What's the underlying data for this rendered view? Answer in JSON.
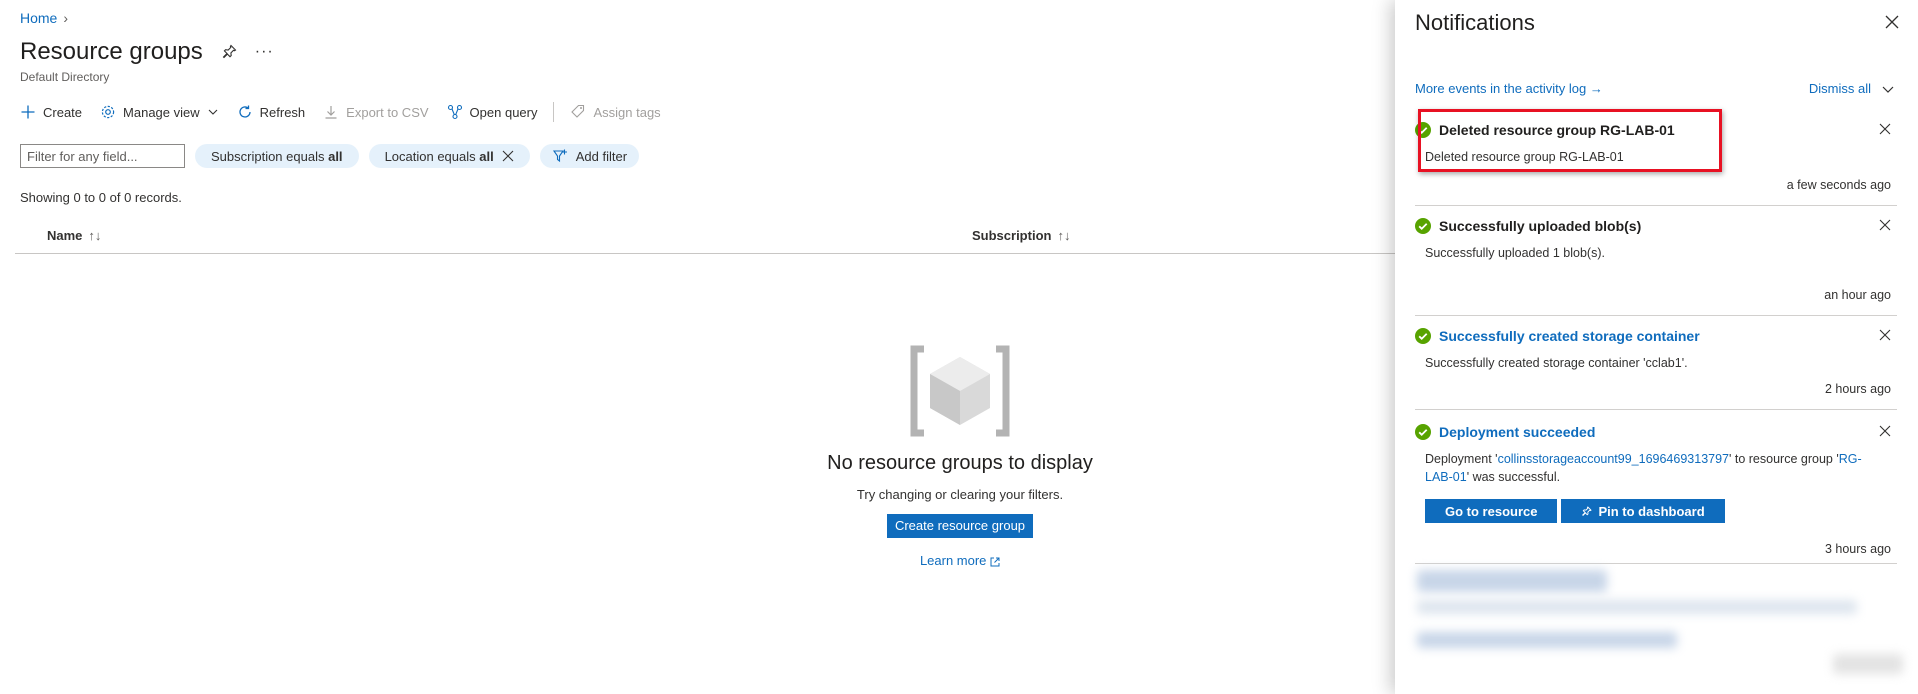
{
  "breadcrumb": {
    "home": "Home",
    "separator": "›"
  },
  "page": {
    "title": "Resource groups",
    "subtitle": "Default Directory"
  },
  "toolbar": {
    "create": "Create",
    "manage_view": "Manage view",
    "refresh": "Refresh",
    "export_csv": "Export to CSV",
    "open_query": "Open query",
    "assign_tags": "Assign tags"
  },
  "filters": {
    "placeholder": "Filter for any field...",
    "subscription_prefix": "Subscription equals",
    "subscription_value": "all",
    "location_prefix": "Location equals",
    "location_value": "all",
    "add_filter": "Add filter"
  },
  "records": "Showing 0 to 0 of 0 records.",
  "table": {
    "columns": [
      "Name",
      "Subscription"
    ]
  },
  "empty_state": {
    "title": "No resource groups to display",
    "subtitle": "Try changing or clearing your filters.",
    "button": "Create resource group",
    "learn_more": "Learn more"
  },
  "notifications": {
    "title": "Notifications",
    "activity_log": "More events in the activity log →",
    "dismiss_all": "Dismiss all",
    "items": [
      {
        "title": "Deleted resource group RG-LAB-01",
        "desc": "Deleted resource group RG-LAB-01",
        "time": "a few seconds ago"
      },
      {
        "title": "Successfully uploaded blob(s)",
        "desc": "Successfully uploaded 1 blob(s).",
        "time": "an hour ago"
      },
      {
        "title": "Successfully created storage container",
        "desc": "Successfully created storage container 'cclab1'.",
        "time": "2 hours ago"
      },
      {
        "title": "Deployment succeeded",
        "desc_prefix": "Deployment '",
        "desc_link1": "collinsstorageaccount99_1696469313797",
        "desc_mid": "' to resource group '",
        "desc_link2": "RG-LAB-01",
        "desc_suffix": "' was successful.",
        "time": "3 hours ago",
        "action_go": "Go to resource",
        "action_pin": "Pin to dashboard"
      }
    ]
  },
  "colors": {
    "accent": "#0f6cbd",
    "success": "#57a300",
    "highlight": "#e81123",
    "pill": "#e5f1fb"
  }
}
